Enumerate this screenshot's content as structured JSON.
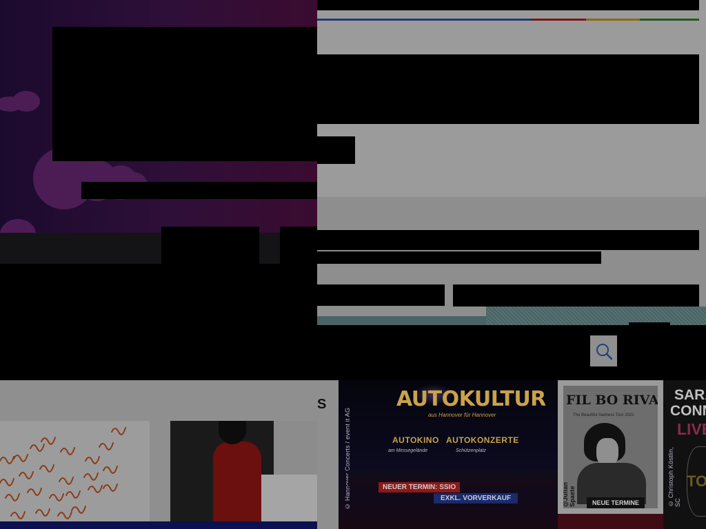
{
  "banners": {
    "autokultur": {
      "title": "AUTOKULTUR",
      "subtitle": "aus Hannover für Hannover",
      "col1_title": "AUTOKINO",
      "col1_sub": "am Messegelände",
      "col2_title": "AUTOKONZERTE",
      "col2_sub": "Schützenplatz",
      "badge1": "NEUER TERMIN: SSIO",
      "badge2": "EXKL. VORVERKAUF",
      "credit": "© Hannover Concerts / event it AG"
    },
    "filbo": {
      "title": "FIL BO RIVA",
      "tour": "The Beautiful Sadness Tour 2021",
      "button": "NEUE TERMINE",
      "credit": "@Julian Spaete"
    },
    "sarah": {
      "line1": "SARA",
      "line2": "CONNO",
      "line3": "LIVE",
      "line4": "TOU",
      "credit": "© Christoph Köstlin, SC"
    }
  },
  "partial_heading": "S",
  "search_icon": "search-icon",
  "colors": {
    "stripe_blue": "#1d3a7a",
    "stripe_red": "#7a1414",
    "stripe_yellow": "#8a6a10",
    "stripe_green": "#1d5a1d",
    "gold": "#c9a24a",
    "badge_red": "#8a1a1a",
    "badge_blue": "#1a2a6a"
  }
}
